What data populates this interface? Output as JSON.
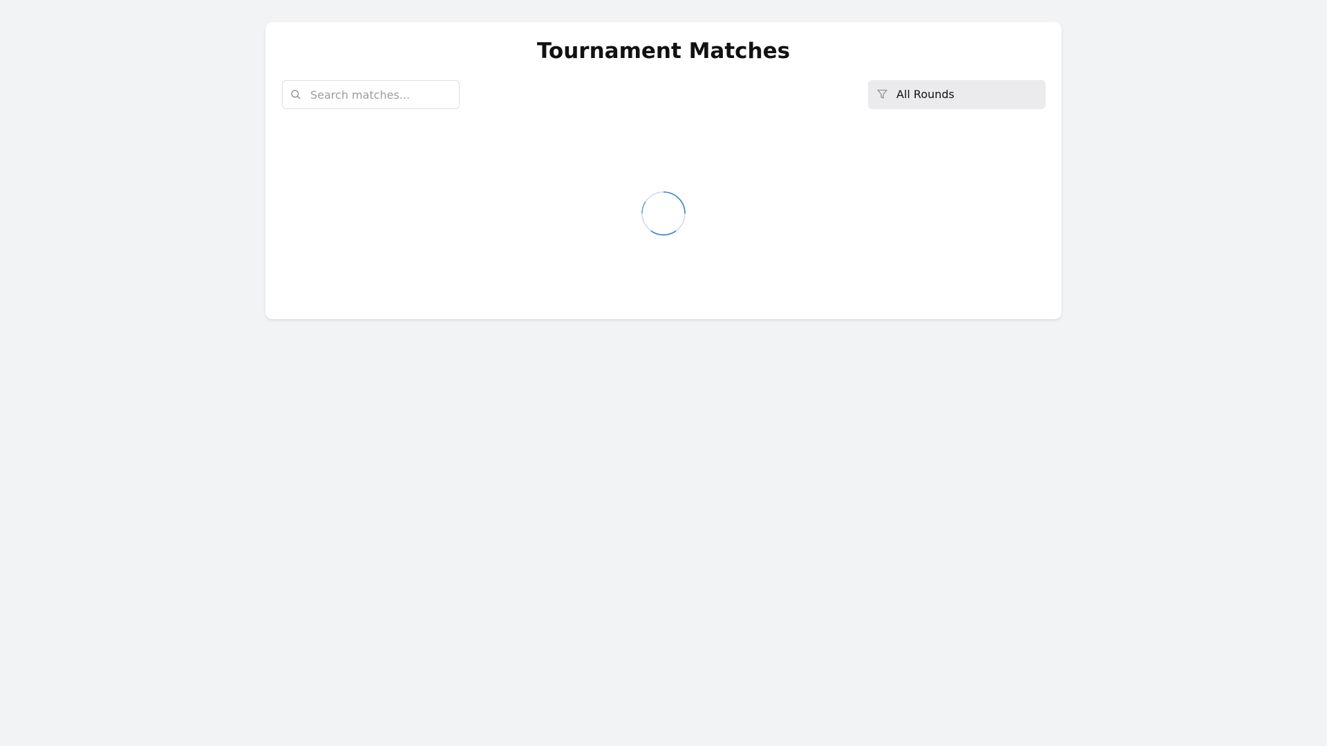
{
  "page": {
    "title": "Tournament Matches"
  },
  "search": {
    "placeholder": "Search matches...",
    "value": "",
    "icon": "search-icon"
  },
  "filter": {
    "selected": "All Rounds",
    "icon": "filter-icon"
  },
  "status": {
    "state": "loading",
    "spinner_color": "#3b7ddd"
  }
}
